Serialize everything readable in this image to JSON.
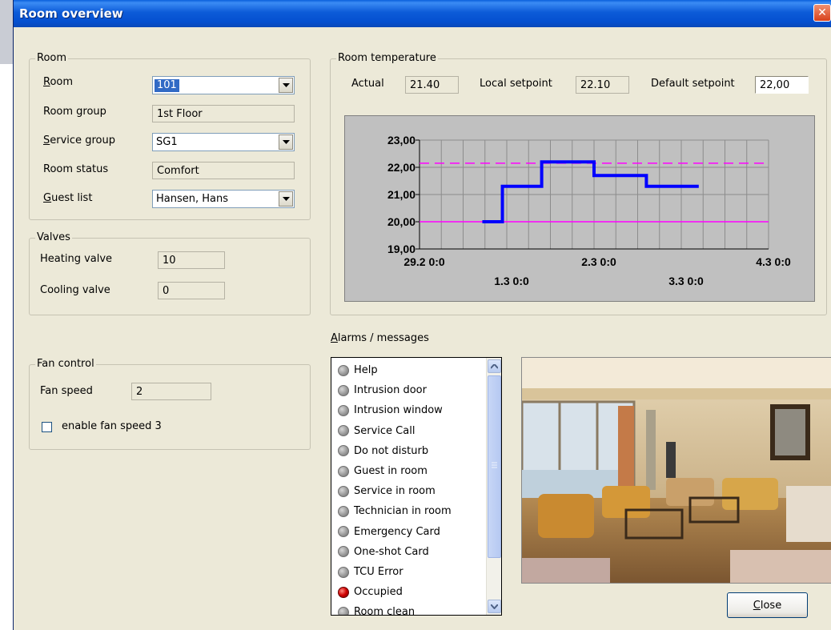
{
  "window": {
    "title": "Room overview",
    "close_label": "✕"
  },
  "room": {
    "group_label": "Room",
    "room_label_hotkey": "R",
    "room_label_rest": "oom",
    "room_value": "101",
    "room_group_label": "Room group",
    "room_group_value": "1st Floor",
    "service_group_label_hotkey": "S",
    "service_group_label_rest": "ervice group",
    "service_group_value": "SG1",
    "room_status_label": "Room status",
    "room_status_value": "Comfort",
    "guest_list_label_hotkey": "G",
    "guest_list_label_rest": "uest list",
    "guest_list_value": "Hansen, Hans"
  },
  "valves": {
    "group_label": "Valves",
    "heating_label": "Heating valve",
    "heating_value": "10",
    "cooling_label": "Cooling valve",
    "cooling_value": "0"
  },
  "fan": {
    "group_label": "Fan control",
    "speed_label": "Fan speed",
    "speed_value": "2",
    "enable3_label": "enable fan speed 3"
  },
  "room_temperature": {
    "group_label": "Room temperature",
    "actual_label": "Actual",
    "actual_value": "21.40",
    "local_label": "Local setpoint",
    "local_value": "22.10",
    "default_label": "Default setpoint",
    "default_value": "22,00"
  },
  "chart_data": {
    "type": "line",
    "ylim": [
      19.0,
      23.0
    ],
    "y_ticks": [
      "19,00",
      "20,00",
      "21,00",
      "22,00",
      "23,00"
    ],
    "x_ticks": [
      {
        "label": "29.2 0:0",
        "pos": 0.0
      },
      {
        "label": "1.3 0:0",
        "pos": 1.0
      },
      {
        "label": "2.3 0:0",
        "pos": 2.0
      },
      {
        "label": "3.3 0:0",
        "pos": 3.0
      },
      {
        "label": "4.3 0:0",
        "pos": 4.0
      }
    ],
    "xlim": [
      0,
      4
    ],
    "series": [
      {
        "color": "#0000ff",
        "points": [
          [
            0.72,
            20.0
          ],
          [
            0.95,
            20.0
          ],
          [
            0.95,
            21.3
          ],
          [
            1.4,
            21.3
          ],
          [
            1.4,
            22.2
          ],
          [
            2.0,
            22.2
          ],
          [
            2.0,
            21.7
          ],
          [
            2.6,
            21.7
          ],
          [
            2.6,
            21.3
          ],
          [
            3.2,
            21.3
          ]
        ]
      }
    ],
    "reference_lines": [
      {
        "value": 22.15,
        "style": "dashed",
        "color": "#ff00ff"
      },
      {
        "value": 20.0,
        "style": "solid",
        "color": "#ff00ff"
      }
    ],
    "grid": true
  },
  "alarms": {
    "label_hotkey": "A",
    "label_rest": "larms / messages",
    "items": [
      {
        "label": "Help",
        "active": false
      },
      {
        "label": "Intrusion door",
        "active": false
      },
      {
        "label": "Intrusion window",
        "active": false
      },
      {
        "label": "Service Call",
        "active": false
      },
      {
        "label": "Do not disturb",
        "active": false
      },
      {
        "label": "Guest in room",
        "active": false
      },
      {
        "label": "Service in room",
        "active": false
      },
      {
        "label": "Technician in room",
        "active": false
      },
      {
        "label": "Emergency Card",
        "active": false
      },
      {
        "label": "One-shot Card",
        "active": false
      },
      {
        "label": "TCU Error",
        "active": false
      },
      {
        "label": "Occupied",
        "active": true
      },
      {
        "label": "Room clean",
        "active": false
      }
    ]
  },
  "footer": {
    "close_hotkey": "C",
    "close_rest": "lose"
  }
}
